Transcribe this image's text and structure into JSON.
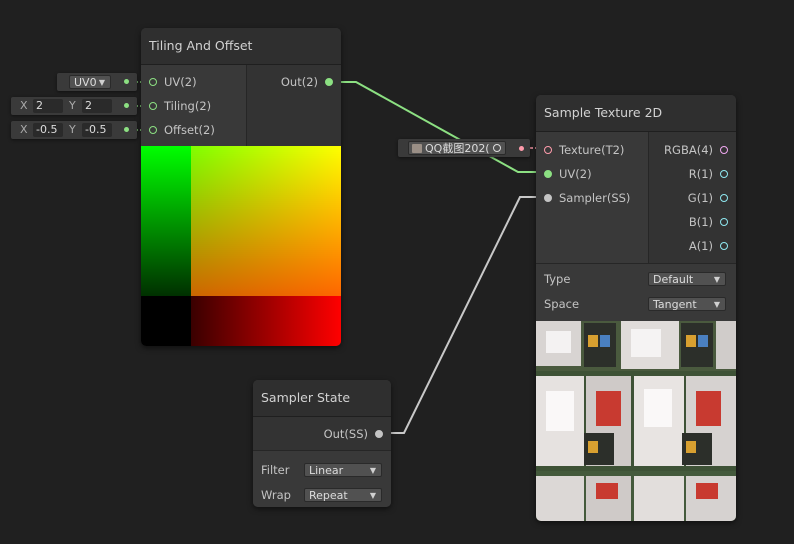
{
  "tiling_node": {
    "title": "Tiling And Offset",
    "inputs": [
      {
        "label": "UV(2)"
      },
      {
        "label": "Tiling(2)"
      },
      {
        "label": "Offset(2)"
      }
    ],
    "output": {
      "label": "Out(2)"
    }
  },
  "uv_field": {
    "value": "UV0"
  },
  "tiling_field": {
    "x_label": "X",
    "x": "2",
    "y_label": "Y",
    "y": "2"
  },
  "offset_field": {
    "x_label": "X",
    "x": "-0.5",
    "y_label": "Y",
    "y": "-0.5"
  },
  "texture_field": {
    "value": "QQ截图202("
  },
  "sample_node": {
    "title": "Sample Texture 2D",
    "inputs": [
      {
        "label": "Texture(T2)"
      },
      {
        "label": "UV(2)"
      },
      {
        "label": "Sampler(SS)"
      }
    ],
    "outputs": [
      {
        "label": "RGBA(4)"
      },
      {
        "label": "R(1)"
      },
      {
        "label": "G(1)"
      },
      {
        "label": "B(1)"
      },
      {
        "label": "A(1)"
      }
    ],
    "type_label": "Type",
    "type_value": "Default",
    "space_label": "Space",
    "space_value": "Tangent"
  },
  "sampler_node": {
    "title": "Sampler State",
    "output": {
      "label": "Out(SS)"
    },
    "filter_label": "Filter",
    "filter_value": "Linear",
    "wrap_label": "Wrap",
    "wrap_value": "Repeat"
  },
  "colors": {
    "wire_vector2": "#8ce082",
    "wire_sampler": "#c8c8c8",
    "wire_texture": "#ff9cac",
    "port_float": "#8fe8f0",
    "canvas": "#202020"
  }
}
